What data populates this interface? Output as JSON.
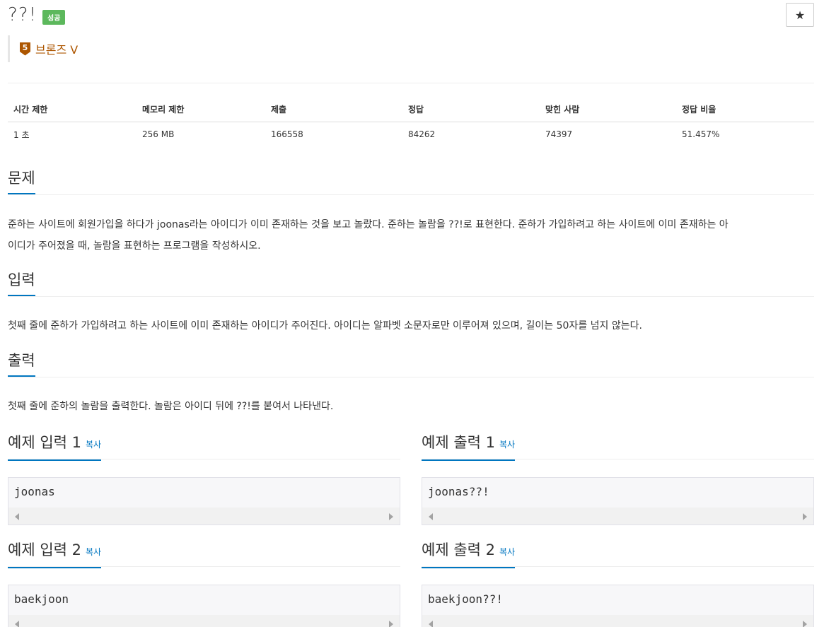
{
  "problem": {
    "title": "??!",
    "result_badge": "성공",
    "star_icon": "★",
    "tier": {
      "number": "5",
      "label": "브론즈 V",
      "color": "#ad5600"
    }
  },
  "stats": {
    "headers": [
      "시간 제한",
      "메모리 제한",
      "제출",
      "정답",
      "맞힌 사람",
      "정답 비율"
    ],
    "values": [
      "1 초",
      "256 MB",
      "166558",
      "84262",
      "74397",
      "51.457%"
    ]
  },
  "sections": {
    "description": {
      "title": "문제",
      "line1": "준하는 사이트에 회원가입을 하다가 joonas라는 아이디가 이미 존재하는 것을 보고 놀랐다. 준하는 놀람을 ??!로 표현한다. 준하가 가입하려고 하는 사이트에 이미 존재하는 아",
      "line2": "이디가 주어졌을 때, 놀람을 표현하는 프로그램을 작성하시오."
    },
    "input": {
      "title": "입력",
      "text": "첫째 줄에 준하가 가입하려고 하는 사이트에 이미 존재하는 아이디가 주어진다. 아이디는 알파벳 소문자로만 이루어져 있으며, 길이는 50자를 넘지 않는다."
    },
    "output": {
      "title": "출력",
      "text": "첫째 줄에 준하의 놀람을 출력한다. 놀람은 아이디 뒤에 ??!를 붙여서 나타낸다."
    }
  },
  "samples": {
    "copy_label": "복사",
    "input1": {
      "title": "예제 입력 1",
      "code": "joonas"
    },
    "output1": {
      "title": "예제 출력 1",
      "code": "joonas??!"
    },
    "input2": {
      "title": "예제 입력 2",
      "code": "baekjoon"
    },
    "output2": {
      "title": "예제 출력 2",
      "code": "baekjoon??!"
    }
  },
  "colors": {
    "accent": "#0076c0",
    "success": "#5cb85c"
  }
}
